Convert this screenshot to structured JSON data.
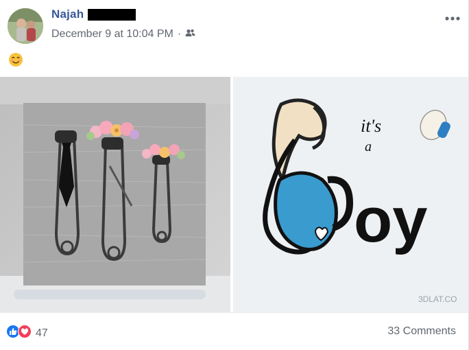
{
  "post": {
    "author": "Najah",
    "timestamp": "December 9 at 10:04 PM",
    "separator": "·",
    "audience_icon": "friends-icon",
    "menu_icon": "more-options-icon",
    "body_emoji": "smiling-face-emoji"
  },
  "photos": [
    {
      "name": "safety-pins-photo"
    },
    {
      "name": "its-a-boy-drawing",
      "lines": [
        "it's",
        "a",
        "oy"
      ],
      "watermark": "3DLAT.CO"
    }
  ],
  "footer": {
    "reaction_icons": [
      "like-icon",
      "love-icon"
    ],
    "reaction_count": "47",
    "comments_label": "33 Comments"
  },
  "colors": {
    "link_blue": "#385898",
    "meta_gray": "#616770",
    "like_blue": "#1877f2",
    "love_red": "#f33e58"
  }
}
